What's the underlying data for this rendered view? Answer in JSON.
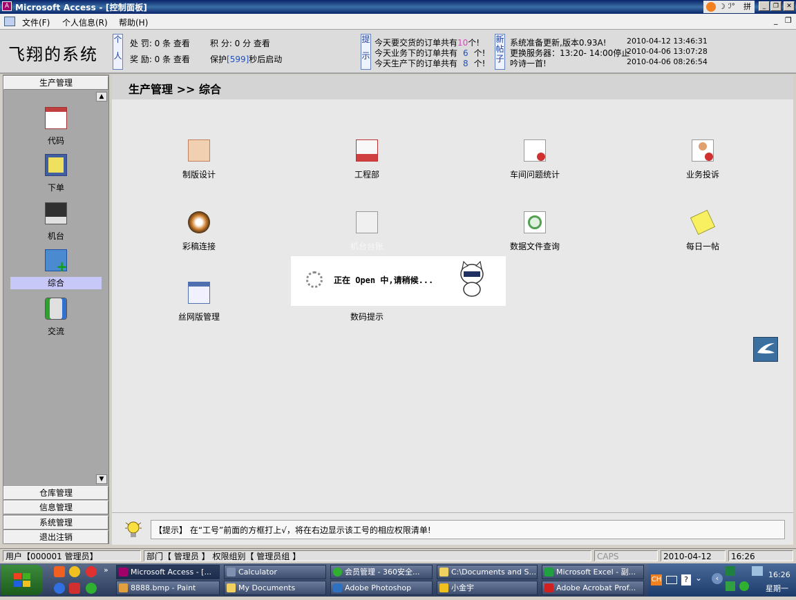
{
  "window": {
    "title": "Microsoft Access - [控制面板]",
    "ime": "拼"
  },
  "menu": [
    {
      "label": "文件(F)"
    },
    {
      "label": "个人信息(R)"
    },
    {
      "label": "帮助(H)"
    }
  ],
  "header": {
    "logo": "飞翔的系统",
    "personal_label": [
      "个",
      "人"
    ],
    "punish": "处  罚: 0 条 查看",
    "points": "积  分: 0 分 查看",
    "reward": "奖  励: 0 条 查看",
    "protect_prefix": "保护",
    "protect_count": "[599]",
    "protect_suffix": "秒后启动",
    "tips_label": [
      "提",
      "示"
    ],
    "tip1_prefix": "今天要交货的订单共有",
    "tip1_count": "10",
    "tip1_suffix": "个!",
    "tip2_prefix": "今天业务下的订单共有",
    "tip2_count": "6",
    "tip2_suffix": "个!",
    "tip3_prefix": "今天生产下的订单共有",
    "tip3_count": "8",
    "tip3_suffix": "个!",
    "newpost_label": [
      "新",
      "帖",
      "子"
    ],
    "posts": [
      {
        "text": "系统准备更新,版本0.93A!",
        "time": "2010-04-12 13:46:31"
      },
      {
        "text": "更换服务器：13:20- 14:00停止",
        "time": "2010-04-06 13:07:28"
      },
      {
        "text": "吟诗一首!",
        "time": "2010-04-06 08:26:54"
      }
    ]
  },
  "sidebar": {
    "top_section": "生产管理",
    "items": [
      {
        "label": "代码",
        "icon": "calendar-icon",
        "selected": false
      },
      {
        "label": "下单",
        "icon": "notepad-icon",
        "selected": false
      },
      {
        "label": "机台",
        "icon": "printer-icon",
        "selected": false
      },
      {
        "label": "综合",
        "icon": "folder-add-icon",
        "selected": true
      },
      {
        "label": "交流",
        "icon": "msn-icon",
        "selected": false
      }
    ],
    "bottom_sections": [
      "仓库管理",
      "信息管理",
      "系统管理",
      "退出注销"
    ]
  },
  "main": {
    "breadcrumb": "生产管理  >> 综合",
    "tiles": [
      {
        "label": "制版设计",
        "icon": "design-icon"
      },
      {
        "label": "工程部",
        "icon": "engineering-icon"
      },
      {
        "label": "车间问题统计",
        "icon": "document-stop-icon"
      },
      {
        "label": "业务投诉",
        "icon": "user-stop-icon"
      },
      {
        "label": "彩稿连接",
        "icon": "disc-icon"
      },
      {
        "label": "机台台账",
        "icon": "notebook-icon"
      },
      {
        "label": "数据文件查询",
        "icon": "magnifier-icon"
      },
      {
        "label": "每日一帖",
        "icon": "note-icon"
      },
      {
        "label": "丝网版管理",
        "icon": "window-icon"
      },
      {
        "label": "数码提示",
        "icon": "none"
      }
    ],
    "loading_text": "正在 Open 中,请稍候...",
    "tip": "【提示】 在“工号”前面的方框打上√，将在右边显示该工号的相应权限清单!"
  },
  "statusbar": {
    "user": "用户【000001 管理员】",
    "dept": "部门【 管理员  】 权限组别【 管理员组  】",
    "caps": "CAPS",
    "date": "2010-04-12",
    "time": "16:26"
  },
  "taskbar": {
    "row1": [
      "Microsoft Access - [...",
      "Calculator",
      "会员管理 - 360安全...",
      "C:\\Documents and S...",
      "Microsoft Excel - 副..."
    ],
    "row2": [
      "8888.bmp - Paint",
      "My Documents",
      "Adobe Photoshop",
      "小金宇",
      "Adobe Acrobat Prof..."
    ],
    "lang": "CH",
    "clock_time": "16:26",
    "clock_day": "星期一"
  },
  "colors": {
    "title_bar": "#0a246a",
    "highlight": "#c8c8f8",
    "count_pink": "#e040c0",
    "count_blue": "#2050c0"
  }
}
